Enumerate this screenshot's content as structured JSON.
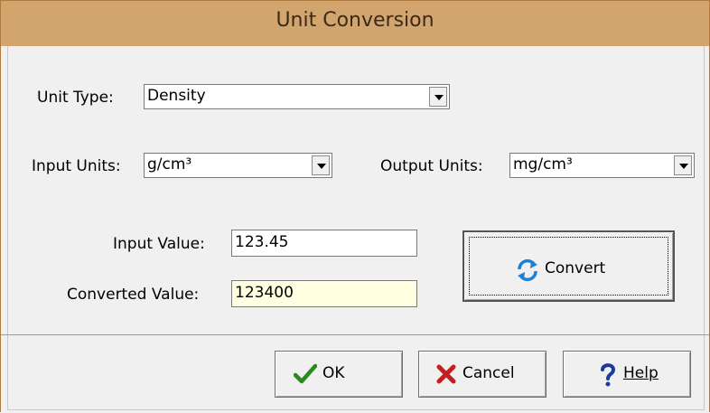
{
  "window": {
    "title": "Unit Conversion"
  },
  "form": {
    "unit_type_label": "Unit Type:",
    "unit_type_value": "Density",
    "input_units_label": "Input Units:",
    "input_units_value": "g/cm³",
    "output_units_label": "Output Units:",
    "output_units_value": "mg/cm³",
    "input_value_label": "Input Value:",
    "input_value": "123.45",
    "converted_value_label": "Converted Value:",
    "converted_value": "123400"
  },
  "buttons": {
    "convert": "Convert",
    "ok": "OK",
    "cancel": "Cancel",
    "help": "Help"
  },
  "icons": {
    "convert": "refresh-icon",
    "ok": "checkmark-icon",
    "cancel": "x-icon",
    "help": "question-icon"
  },
  "colors": {
    "titlebar": "#d2a56e",
    "readonly_field": "#ffffe1",
    "convert_icon": "#1e7fd6",
    "ok_icon": "#2a8a1e",
    "cancel_icon": "#c41e1e",
    "help_icon": "#1a3aa0"
  }
}
